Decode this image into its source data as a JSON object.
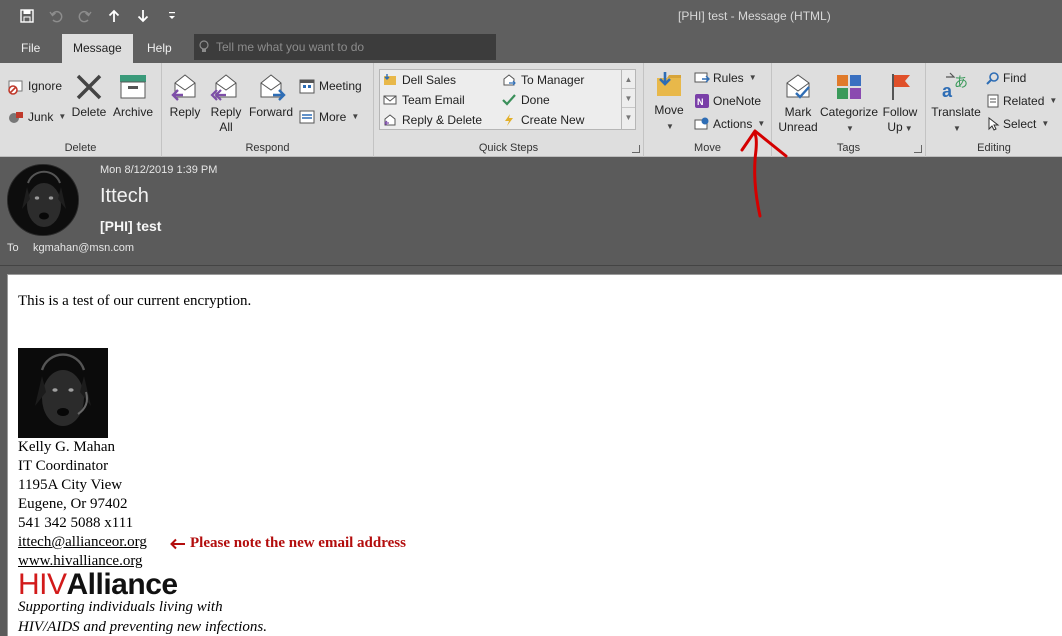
{
  "window": {
    "title": "[PHI] test  -  Message (HTML)"
  },
  "qat": [
    "save-icon",
    "undo-icon",
    "redo-icon",
    "up-arrow-icon",
    "down-arrow-icon",
    "customize-icon"
  ],
  "tabs": [
    {
      "label": "File",
      "active": false
    },
    {
      "label": "Message",
      "active": true
    },
    {
      "label": "Help",
      "active": false
    }
  ],
  "tell_me": {
    "placeholder": "Tell me what you want to do"
  },
  "ribbon": {
    "delete": {
      "label": "Delete",
      "ignore": "Ignore",
      "junk": "Junk",
      "delete_btn": "Delete",
      "archive": "Archive"
    },
    "respond": {
      "label": "Respond",
      "reply": "Reply",
      "reply_all_1": "Reply",
      "reply_all_2": "All",
      "forward": "Forward",
      "meeting": "Meeting",
      "more": "More"
    },
    "quick_steps": {
      "label": "Quick Steps",
      "items": [
        "Dell Sales",
        "Team Email",
        "Reply & Delete",
        "To Manager",
        "Done",
        "Create New"
      ]
    },
    "move": {
      "label": "Move",
      "move_btn": "Move",
      "rules": "Rules",
      "onenote": "OneNote",
      "actions": "Actions"
    },
    "tags": {
      "label": "Tags",
      "mark_unread_1": "Mark",
      "mark_unread_2": "Unread",
      "categorize": "Categorize",
      "follow_up_1": "Follow",
      "follow_up_2": "Up"
    },
    "editing": {
      "label": "Editing",
      "translate": "Translate",
      "find": "Find",
      "related": "Related",
      "select": "Select"
    }
  },
  "header": {
    "date": "Mon 8/12/2019 1:39 PM",
    "sender": "Ittech",
    "subject": "[PHI] test",
    "to_label": "To",
    "to": "kgmahan@msn.com"
  },
  "body": {
    "intro": "This is a test of our current encryption.",
    "signature": {
      "name": "Kelly G. Mahan",
      "title": "IT Coordinator",
      "address1": "1195A City View",
      "address2": "Eugene, Or 97402",
      "phone": "541 342 5088 x111",
      "email": "ittech@allianceor.org",
      "website": "www.hivalliance.org",
      "logo_hiv": "HIV",
      "logo_alliance": "Alliance",
      "tagline1": "Supporting individuals living with",
      "tagline2": "HIV/AIDS and preventing new infections."
    },
    "note": "Please note the new email address"
  },
  "colors": {
    "ribbon_bg": "#dedede",
    "chrome_dark": "#5f5f5f",
    "annotation_red": "#d40000",
    "note_red": "#b30d0d",
    "logo_red": "#d21a1a"
  }
}
